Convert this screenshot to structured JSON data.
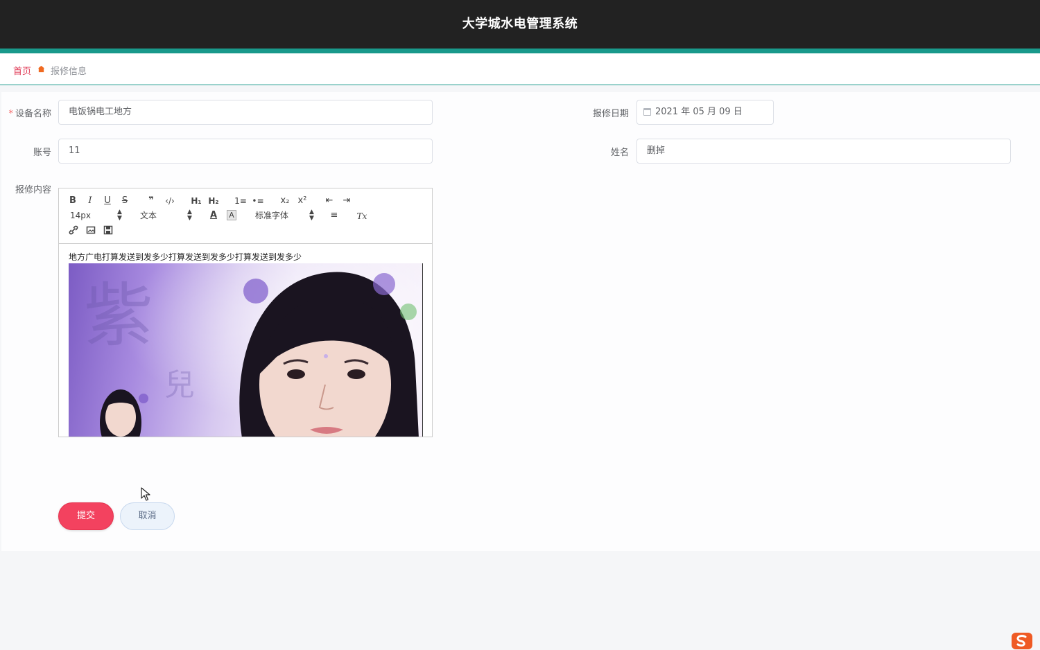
{
  "header": {
    "title": "大学城水电管理系统"
  },
  "breadcrumb": {
    "home": "首页",
    "current": "报修信息"
  },
  "form": {
    "device_name": {
      "label": "设备名称",
      "required_mark": "*",
      "value": "电饭锅电工地方"
    },
    "repair_date": {
      "label": "报修日期",
      "value": "2021 年 05 月 09 日"
    },
    "account": {
      "label": "账号",
      "value": "11"
    },
    "name": {
      "label": "姓名",
      "value": "删掉"
    },
    "content": {
      "label": "报修内容",
      "text": "地方广电打算发送到发多少打算发送到发多少打算发送到发多少",
      "toolbar": {
        "bold": "B",
        "italic": "I",
        "underline": "U",
        "strike": "S",
        "quote": "❞",
        "code": "‹/›",
        "h1": "H₁",
        "h2": "H₂",
        "ordered_list": "1≡",
        "bullet_list": "•≡",
        "subscript": "x₂",
        "superscript": "x²",
        "outdent": "⇤",
        "indent": "⇥",
        "size": "14px",
        "header": "文本",
        "color": "A",
        "background": "A",
        "font": "标准字体",
        "align": "≡",
        "clean": "Tx",
        "link": "🔗",
        "image": "▣",
        "video": "▤"
      }
    }
  },
  "buttons": {
    "submit": "提交",
    "cancel": "取消"
  },
  "colors": {
    "topbar": "#222222",
    "accent": "#19998b",
    "submit": "#f3425f",
    "home_link": "#e03d58"
  }
}
